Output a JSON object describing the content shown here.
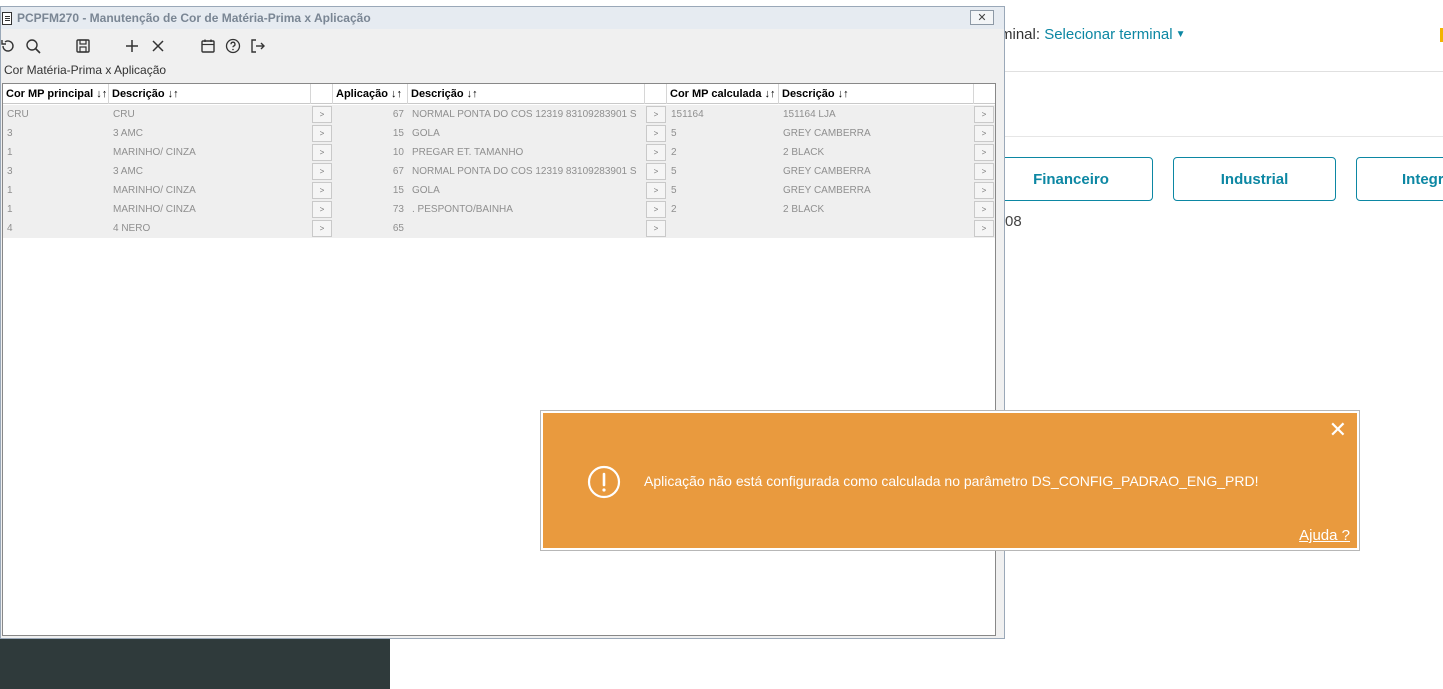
{
  "background": {
    "terminal_label": "minal:",
    "terminal_link": "Selecionar terminal",
    "modules": [
      "Financeiro",
      "Industrial",
      "Integra"
    ],
    "fragment_text": "08"
  },
  "window": {
    "title": "PCPFM270 - Manutenção de Cor de Matéria-Prima x Aplicação",
    "close_glyph": "✕",
    "section_label": "Cor Matéria-Prima x Aplicação"
  },
  "toolbar": {
    "icons": [
      "refresh-icon",
      "search-icon",
      "save-icon",
      "add-icon",
      "delete-icon",
      "calendar-icon",
      "help-icon",
      "exit-icon"
    ]
  },
  "grid": {
    "headers": {
      "cor_mp": "Cor MP principal ↓↑",
      "descricao1": "Descrição ↓↑",
      "aplicacao": "Aplicação ↓↑",
      "descricao2": "Descrição ↓↑",
      "cor_calc": "Cor MP calculada ↓↑",
      "descricao3": "Descrição ↓↑"
    },
    "button_label": ">",
    "rows": [
      {
        "cor": "CRU",
        "desc1": "CRU",
        "apl": "67",
        "desc2": "NORMAL PONTA DO COS 12319 83109283901 S",
        "calc": "151164",
        "desc3": "151164 LJA"
      },
      {
        "cor": "3",
        "desc1": "3 AMC",
        "apl": "15",
        "desc2": "GOLA",
        "calc": "5",
        "desc3": "GREY CAMBERRA"
      },
      {
        "cor": "1",
        "desc1": "MARINHO/ CINZA",
        "apl": "10",
        "desc2": "PREGAR ET. TAMANHO",
        "calc": "2",
        "desc3": "2 BLACK"
      },
      {
        "cor": "3",
        "desc1": "3 AMC",
        "apl": "67",
        "desc2": "NORMAL PONTA DO COS 12319 83109283901 S",
        "calc": "5",
        "desc3": "GREY CAMBERRA"
      },
      {
        "cor": "1",
        "desc1": "MARINHO/ CINZA",
        "apl": "15",
        "desc2": "GOLA",
        "calc": "5",
        "desc3": "GREY CAMBERRA"
      },
      {
        "cor": "1",
        "desc1": "MARINHO/ CINZA",
        "apl": "73",
        "desc2": ". PESPONTO/BAINHA",
        "calc": "2",
        "desc3": "2 BLACK"
      },
      {
        "cor": "4",
        "desc1": "4 NERO",
        "apl": "65",
        "desc2": "",
        "calc": "",
        "desc3": ""
      }
    ]
  },
  "toast": {
    "message": "Aplicação não está configurada como calculada no parâmetro DS_CONFIG_PADRAO_ENG_PRD!",
    "help_link": "Ajuda ?",
    "close_glyph": "✕",
    "color": "#e99a3e"
  }
}
